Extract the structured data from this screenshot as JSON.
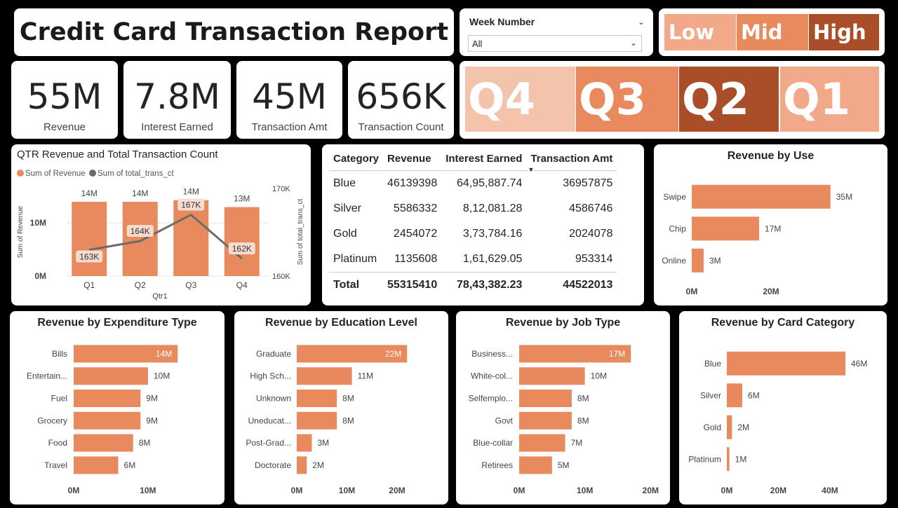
{
  "title": "Credit Card Transaction Report",
  "slicer": {
    "label": "Week Number",
    "value": "All"
  },
  "colors": {
    "accent": "#E8895E",
    "low": "#F1A989",
    "mid": "#E8895E",
    "high": "#A94E29",
    "q_light": "#F4C3AC",
    "q_mid": "#E8895E",
    "q_dark": "#A94E29",
    "q_soft": "#F1A989",
    "line": "#6b6b6b"
  },
  "levels": [
    "Low",
    "Mid",
    "High"
  ],
  "quarters_legend": [
    "Q4",
    "Q3",
    "Q2",
    "Q1"
  ],
  "kpis": [
    {
      "value": "55M",
      "label": "Revenue"
    },
    {
      "value": "7.8M",
      "label": "Interest Earned"
    },
    {
      "value": "45M",
      "label": "Transaction Amt"
    },
    {
      "value": "656K",
      "label": "Transaction Count"
    }
  ],
  "table": {
    "headers": [
      "Category",
      "Revenue",
      "Interest Earned",
      "Transaction Amt"
    ],
    "rows": [
      [
        "Blue",
        "46139398",
        "64,95,887.74",
        "36957875"
      ],
      [
        "Silver",
        "5586332",
        "8,12,081.28",
        "4586746"
      ],
      [
        "Gold",
        "2454072",
        "3,73,784.16",
        "2024078"
      ],
      [
        "Platinum",
        "1135608",
        "1,61,629.05",
        "953314"
      ]
    ],
    "total": [
      "Total",
      "55315410",
      "78,43,382.23",
      "44522013"
    ]
  },
  "chart_data": [
    {
      "type": "bar+line",
      "title": "QTR Revenue and Total Transaction Count",
      "legend": [
        "Sum of Revenue",
        "Sum of total_trans_ct"
      ],
      "categories": [
        "Q1",
        "Q2",
        "Q3",
        "Q4"
      ],
      "xlabel": "Qtr1",
      "ylabel": "Sum of Revenue",
      "y2label": "Sum of total_trans_ct",
      "yticks": [
        "0M",
        "10M"
      ],
      "y2ticks": [
        "160K",
        "170K"
      ],
      "ylim": [
        0,
        16500000
      ],
      "y2lim": [
        160000,
        170000
      ],
      "series": [
        {
          "name": "Sum of Revenue",
          "values": [
            14000000,
            14000000,
            14300000,
            13000000
          ],
          "labels": [
            "14M",
            "14M",
            "14M",
            "13M"
          ]
        },
        {
          "name": "Sum of total_trans_ct",
          "values": [
            163000,
            164000,
            167000,
            162000
          ],
          "labels": [
            "163K",
            "164K",
            "167K",
            "162K"
          ]
        }
      ]
    },
    {
      "type": "bar",
      "orientation": "horizontal",
      "title": "Revenue by Use",
      "categories": [
        "Swipe",
        "Chip",
        "Online"
      ],
      "values": [
        35,
        17,
        3
      ],
      "labels": [
        "35M",
        "17M",
        "3M"
      ],
      "xlim": [
        0,
        40
      ],
      "xticks": [
        0,
        20
      ],
      "xtick_labels": [
        "0M",
        "20M"
      ]
    },
    {
      "type": "bar",
      "orientation": "horizontal",
      "title": "Revenue by Expenditure Type",
      "categories": [
        "Bills",
        "Entertain...",
        "Fuel",
        "Grocery",
        "Food",
        "Travel"
      ],
      "values": [
        14,
        10,
        9,
        9,
        8,
        6
      ],
      "labels": [
        "14M",
        "10M",
        "9M",
        "9M",
        "8M",
        "6M"
      ],
      "xlim": [
        0,
        17
      ],
      "xticks": [
        0,
        10
      ],
      "xtick_labels": [
        "0M",
        "10M"
      ]
    },
    {
      "type": "bar",
      "orientation": "horizontal",
      "title": "Revenue by Education Level",
      "categories": [
        "Graduate",
        "High Sch...",
        "Unknown",
        "Uneducat...",
        "Post-Grad...",
        "Doctorate"
      ],
      "values": [
        22,
        11,
        8,
        8,
        3,
        2
      ],
      "labels": [
        "22M",
        "11M",
        "8M",
        "8M",
        "3M",
        "2M"
      ],
      "xlim": [
        0,
        27
      ],
      "xticks": [
        0,
        10,
        20
      ],
      "xtick_labels": [
        "0M",
        "10M",
        "20M"
      ]
    },
    {
      "type": "bar",
      "orientation": "horizontal",
      "title": "Revenue by Job Type",
      "categories": [
        "Business...",
        "White-col...",
        "Selfemplo...",
        "Govt",
        "Blue-collar",
        "Retirees"
      ],
      "values": [
        17,
        10,
        8,
        8,
        7,
        5
      ],
      "labels": [
        "17M",
        "10M",
        "8M",
        "8M",
        "7M",
        "5M"
      ],
      "xlim": [
        0,
        20.5
      ],
      "xticks": [
        0,
        10,
        20
      ],
      "xtick_labels": [
        "0M",
        "10M",
        "20M"
      ]
    },
    {
      "type": "bar",
      "orientation": "horizontal",
      "title": "Revenue by Card Category",
      "categories": [
        "Blue",
        "Silver",
        "Gold",
        "Platinum"
      ],
      "values": [
        46,
        6,
        2,
        1
      ],
      "labels": [
        "46M",
        "6M",
        "2M",
        "1M"
      ],
      "xlim": [
        0,
        49
      ],
      "xticks": [
        0,
        20,
        40
      ],
      "xtick_labels": [
        "0M",
        "20M",
        "40M"
      ]
    }
  ]
}
